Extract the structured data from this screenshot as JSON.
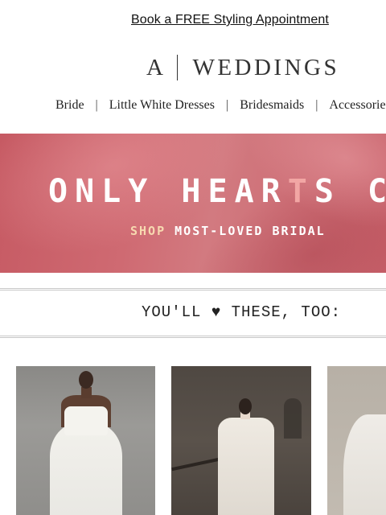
{
  "promo": {
    "link_text": "Book a FREE Styling Appointment"
  },
  "logo": {
    "letter": "A",
    "word": "WEDDINGS"
  },
  "nav": {
    "items": [
      {
        "label": "Bride"
      },
      {
        "label": "Little White Dresses"
      },
      {
        "label": "Bridesmaids"
      },
      {
        "label": "Accessories"
      }
    ],
    "separator": "|"
  },
  "hero": {
    "headline_part1": "ONLY HEAR",
    "headline_accent": "T",
    "headline_part2": "S CL",
    "sub_shop": "SHOP",
    "sub_rest": "MOST-LOVED BRIDAL"
  },
  "recommendations": {
    "heading": "YOU'LL ♥ THESE, TOO:"
  },
  "products": [
    {
      "image": "strapless-white-gown-photo"
    },
    {
      "image": "off-shoulder-lace-gown-photo"
    },
    {
      "image": "white-gown-photo-cropped"
    }
  ],
  "colors": {
    "hero_bg": "#c96a72",
    "hero_accent": "#f2a6a4",
    "shop_accent": "#f7d9b0"
  }
}
